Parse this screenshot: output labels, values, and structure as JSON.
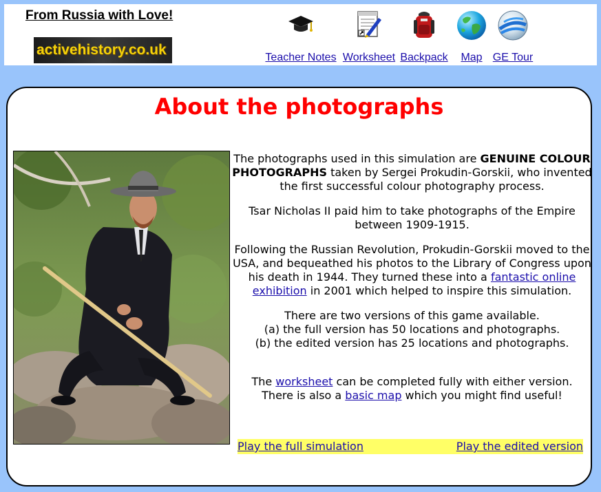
{
  "header": {
    "site_title": "From Russia with Love!",
    "logo_text": "activehistory.co.uk",
    "nav": [
      {
        "label": "Teacher Notes",
        "icon": "graduation-cap-icon"
      },
      {
        "label": "Worksheet",
        "icon": "worksheet-pen-icon"
      },
      {
        "label": "Backpack",
        "icon": "backpack-icon"
      },
      {
        "label": "Map",
        "icon": "globe-icon"
      },
      {
        "label": "GE Tour",
        "icon": "google-earth-icon"
      }
    ]
  },
  "main": {
    "title": "About the photographs",
    "portrait_alt": "Sergei Prokudin-Gorskii seated on rocks",
    "p1": {
      "before": "The photographs used in this simulation are ",
      "bold": "GENUINE COLOUR PHOTOGRAPHS",
      "after": " taken by Sergei Prokudin-Gorskii, who invented the first successful colour photography process."
    },
    "p2": "Tsar Nicholas II paid him to take photographs of the Empire between 1909-1915.",
    "p3": {
      "before": "Following the Russian Revolution, Prokudin-Gorskii moved to the USA, and bequeathed his photos to the Library of Congress upon his death in 1944. They turned these into a ",
      "link": "fantastic online exhibition",
      "after": " in 2001 which helped to inspire this simulation."
    },
    "p4": {
      "line1": "There are two versions of this game available.",
      "line2": "(a) the full version has 50 locations and photographs.",
      "line3": "(b) the edited version has 25 locations and photographs."
    },
    "p5": {
      "the": "The ",
      "worksheet_link": "worksheet",
      "mid": " can be completed fully with either version.",
      "line2_before": "There is also a ",
      "map_link": "basic map",
      "line2_after": " which you might find useful!"
    },
    "play_full": "Play the full simulation",
    "play_edited": "Play the edited version"
  }
}
